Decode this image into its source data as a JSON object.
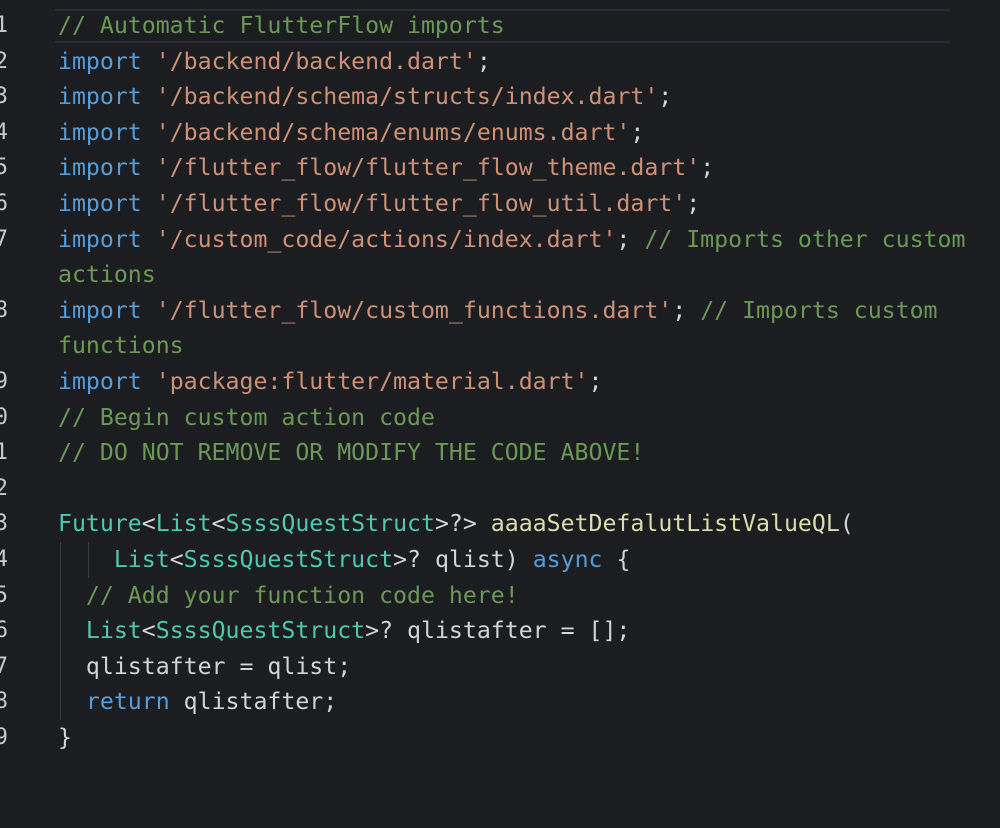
{
  "editor": {
    "colors": {
      "background": "#1b1d20",
      "comment": "#6a9955",
      "keyword": "#569cd6",
      "string": "#ce9178",
      "type": "#4ec9b0",
      "function": "#dcdcaa",
      "plain": "#d4d4d4"
    },
    "lines": [
      {
        "number": "1",
        "tokens": [
          [
            "comment",
            "// Automatic FlutterFlow imports"
          ]
        ]
      },
      {
        "number": "2",
        "tokens": [
          [
            "kw",
            "import"
          ],
          [
            "plain",
            " "
          ],
          [
            "str",
            "'/backend/backend.dart'"
          ],
          [
            "punc",
            ";"
          ]
        ]
      },
      {
        "number": "3",
        "tokens": [
          [
            "kw",
            "import"
          ],
          [
            "plain",
            " "
          ],
          [
            "str",
            "'/backend/schema/structs/index.dart'"
          ],
          [
            "punc",
            ";"
          ]
        ]
      },
      {
        "number": "4",
        "tokens": [
          [
            "kw",
            "import"
          ],
          [
            "plain",
            " "
          ],
          [
            "str",
            "'/backend/schema/enums/enums.dart'"
          ],
          [
            "punc",
            ";"
          ]
        ]
      },
      {
        "number": "5",
        "tokens": [
          [
            "kw",
            "import"
          ],
          [
            "plain",
            " "
          ],
          [
            "str",
            "'/flutter_flow/flutter_flow_theme.dart'"
          ],
          [
            "punc",
            ";"
          ]
        ]
      },
      {
        "number": "6",
        "tokens": [
          [
            "kw",
            "import"
          ],
          [
            "plain",
            " "
          ],
          [
            "str",
            "'/flutter_flow/flutter_flow_util.dart'"
          ],
          [
            "punc",
            ";"
          ]
        ]
      },
      {
        "number": "7",
        "tokens": [
          [
            "kw",
            "import"
          ],
          [
            "plain",
            " "
          ],
          [
            "str",
            "'/custom_code/actions/index.dart'"
          ],
          [
            "punc",
            "; "
          ],
          [
            "comment",
            "// Imports other custom actions"
          ]
        ]
      },
      {
        "number": "8",
        "tokens": [
          [
            "kw",
            "import"
          ],
          [
            "plain",
            " "
          ],
          [
            "str",
            "'/flutter_flow/custom_functions.dart'"
          ],
          [
            "punc",
            "; "
          ],
          [
            "comment",
            "// Imports custom functions"
          ]
        ]
      },
      {
        "number": "9",
        "tokens": [
          [
            "kw",
            "import"
          ],
          [
            "plain",
            " "
          ],
          [
            "str",
            "'package:flutter/material.dart'"
          ],
          [
            "punc",
            ";"
          ]
        ]
      },
      {
        "number": "10",
        "tokens": [
          [
            "comment",
            "// Begin custom action code"
          ]
        ]
      },
      {
        "number": "11",
        "tokens": [
          [
            "comment",
            "// DO NOT REMOVE OR MODIFY THE CODE ABOVE!"
          ]
        ]
      },
      {
        "number": "12",
        "tokens": []
      },
      {
        "number": "13",
        "tokens": [
          [
            "type",
            "Future"
          ],
          [
            "punc",
            "<"
          ],
          [
            "type",
            "List"
          ],
          [
            "punc",
            "<"
          ],
          [
            "type",
            "SsssQuestStruct"
          ],
          [
            "punc",
            ">?> "
          ],
          [
            "fn",
            "aaaaSetDefalutListValueQL"
          ],
          [
            "punc",
            "("
          ]
        ]
      },
      {
        "number": "14",
        "tokens": [
          [
            "plain",
            "    "
          ],
          [
            "type",
            "List"
          ],
          [
            "punc",
            "<"
          ],
          [
            "type",
            "SsssQuestStruct"
          ],
          [
            "punc",
            ">? "
          ],
          [
            "plain",
            "qlist"
          ],
          [
            "punc",
            ") "
          ],
          [
            "kw",
            "async"
          ],
          [
            "punc",
            " {"
          ]
        ]
      },
      {
        "number": "15",
        "tokens": [
          [
            "plain",
            "  "
          ],
          [
            "comment",
            "// Add your function code here!"
          ]
        ]
      },
      {
        "number": "16",
        "tokens": [
          [
            "plain",
            "  "
          ],
          [
            "type",
            "List"
          ],
          [
            "punc",
            "<"
          ],
          [
            "type",
            "SsssQuestStruct"
          ],
          [
            "punc",
            ">? "
          ],
          [
            "plain",
            "qlistafter = [];"
          ]
        ]
      },
      {
        "number": "17",
        "tokens": [
          [
            "plain",
            "  qlistafter = qlist;"
          ]
        ]
      },
      {
        "number": "18",
        "tokens": [
          [
            "plain",
            "  "
          ],
          [
            "kw",
            "return"
          ],
          [
            "plain",
            " qlistafter;"
          ]
        ]
      },
      {
        "number": "19",
        "tokens": [
          [
            "punc",
            "}"
          ]
        ]
      }
    ]
  }
}
